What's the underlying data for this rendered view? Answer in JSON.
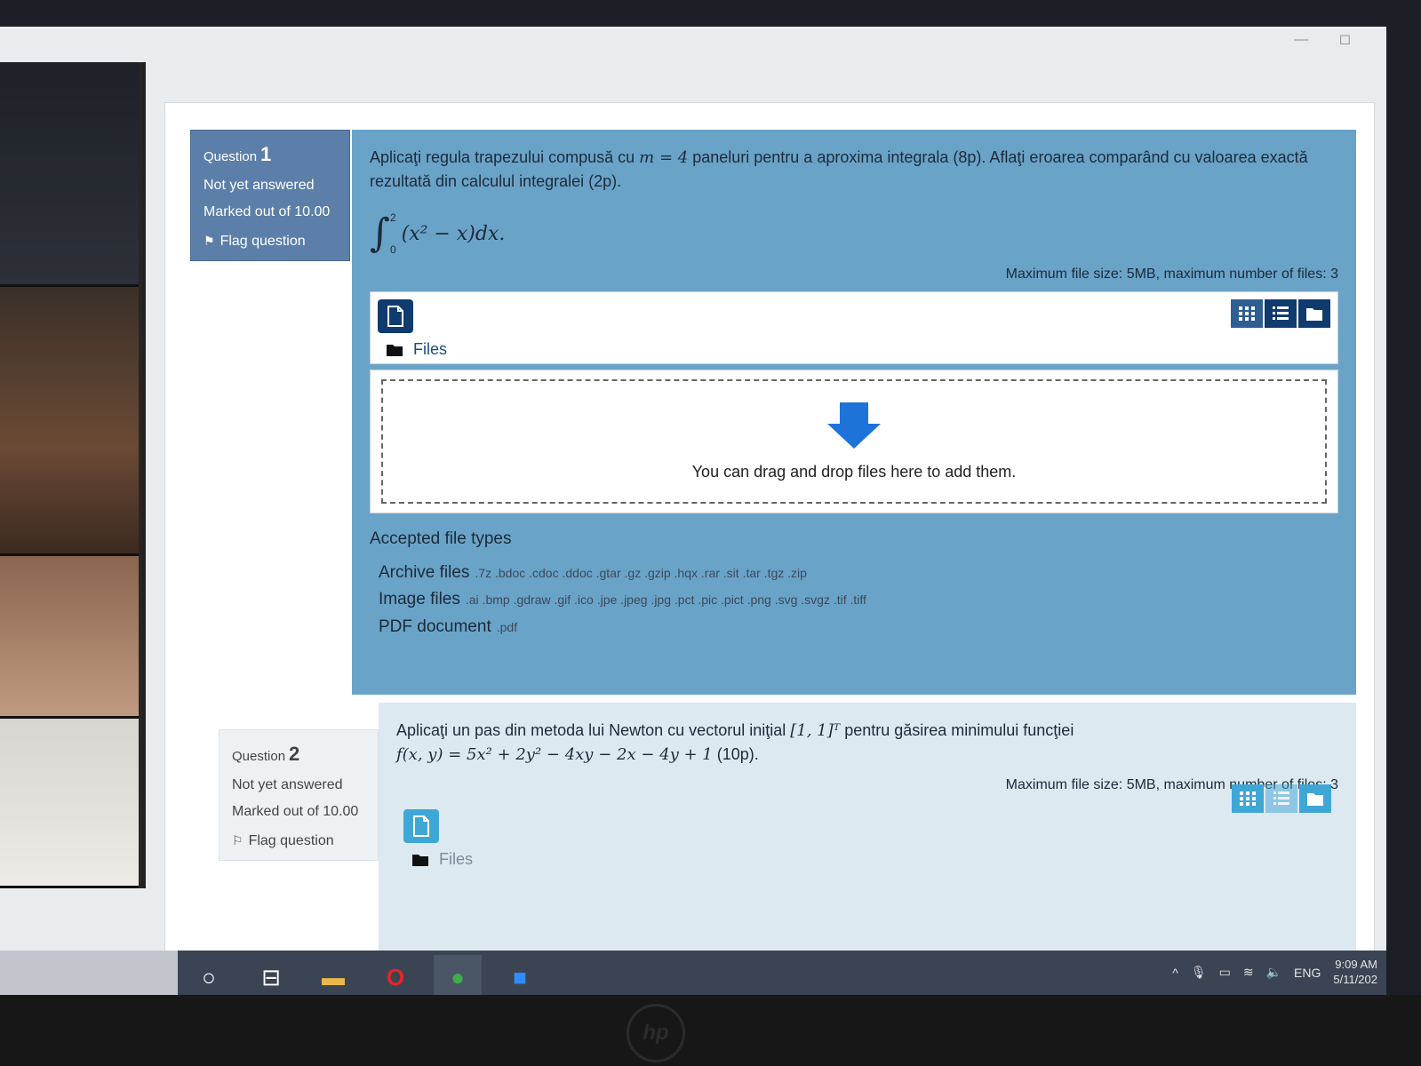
{
  "window": {
    "minimize": "—",
    "maximize": "◻"
  },
  "q1": {
    "label": "Question",
    "number": "1",
    "status": "Not yet answered",
    "marked": "Marked out of 10.00",
    "flag": "Flag question",
    "text_a": "Aplicaţi regula trapezului compusă cu ",
    "text_m": "m = 4",
    "text_b": " paneluri pentru a aproxima integrala (8p). Aflaţi eroarea comparând cu valoarea exactă rezultată din calculul integralei (2p).",
    "integral_upper": "2",
    "integral_lower": "0",
    "integral_sign": "∫",
    "integrand": "(x² − x)dx.",
    "max_size": "Maximum file size: 5MB, maximum number of files: 3",
    "files_label": "Files",
    "drop_text": "You can drag and drop files here to add them.",
    "accepted_title": "Accepted file types",
    "accepted": [
      {
        "name": "Archive files",
        "ext": ".7z .bdoc .cdoc .ddoc .gtar .gz .gzip .hqx .rar .sit .tar .tgz .zip"
      },
      {
        "name": "Image files",
        "ext": ".ai .bmp .gdraw .gif .ico .jpe .jpeg .jpg .pct .pic .pict .png .svg .svgz .tif .tiff"
      },
      {
        "name": "PDF document",
        "ext": ".pdf"
      }
    ]
  },
  "q2": {
    "label": "Question",
    "number": "2",
    "status": "Not yet answered",
    "marked": "Marked out of 10.00",
    "flag": "Flag question",
    "text_a": "Aplicaţi un pas din metoda lui Newton cu vectorul iniţial ",
    "vector": "[1, 1]ᵀ",
    "text_b": " pentru găsirea minimului funcţiei",
    "formula": "f(x, y) = 5x² + 2y² − 4xy − 2x − 4y + 1",
    "points": " (10p).",
    "max_size": "Maximum file size: 5MB, maximum number of files: 3",
    "files_label": "Files"
  },
  "taskbar": {
    "start_icon": "○",
    "taskview_icon": "⊟",
    "explorer_icon": "▬",
    "opera_icon": "O",
    "chrome_icon": "●",
    "zoom_icon": "■",
    "tray_lang": "ENG",
    "time": "9:09 AM",
    "date": "5/11/202"
  },
  "bezel": {
    "logo": "hp"
  },
  "colors": {
    "q1_panel": "#6aa3c8",
    "q1_info": "#5b7fa8",
    "accent_dark": "#0f3b6e",
    "accent_light": "#3fa7d6",
    "drop_arrow": "#1e73d8"
  }
}
